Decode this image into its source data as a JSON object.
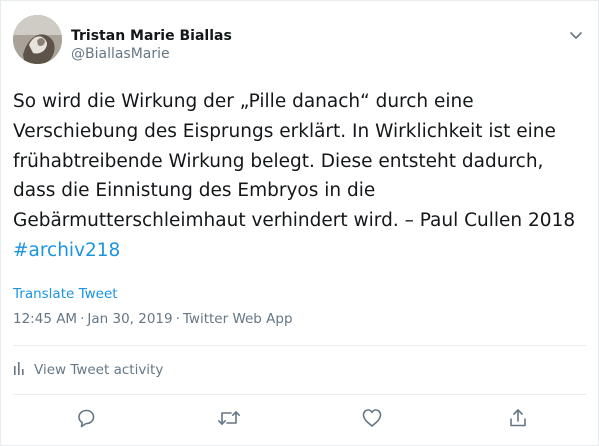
{
  "user": {
    "display_name": "Tristan Marie Biallas",
    "handle": "@BiallasMarie"
  },
  "tweet": {
    "text": "So wird die Wirkung der „Pille danach“ durch eine Verschiebung des Eisprungs erklärt. In Wirklichkeit ist eine frühabtreibende Wirkung belegt. Diese entsteht dadurch, dass die Einnistung des Embryos in die Gebärmutterschleimhaut verhindert wird. – Paul Cullen 2018 ",
    "hashtag": "#archiv218",
    "translate_label": "Translate Tweet",
    "time": "12:45 AM",
    "date": "Jan 30, 2019",
    "source": "Twitter Web App",
    "separator": "·"
  },
  "activity": {
    "label": "View Tweet activity",
    "icon": "bar-chart-icon"
  },
  "actions": {
    "icons": [
      "reply-icon",
      "retweet-icon",
      "like-icon",
      "share-icon"
    ]
  },
  "colors": {
    "text": "#14171a",
    "secondary": "#657786",
    "link": "#1b95e0",
    "divider": "#e6ecf0"
  }
}
